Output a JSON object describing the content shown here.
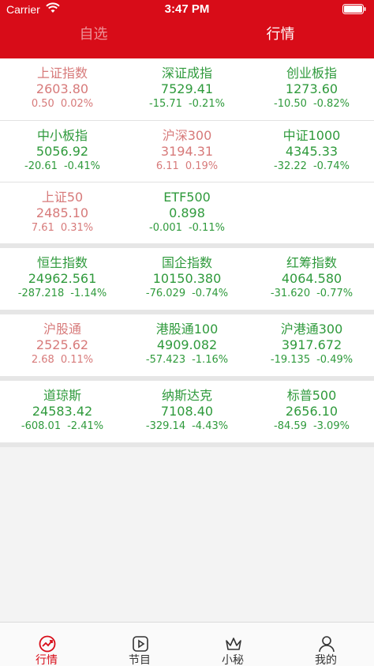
{
  "status_bar": {
    "carrier": "Carrier",
    "time": "3:47 PM"
  },
  "header": {
    "tabs": [
      {
        "label": "自选",
        "active": false
      },
      {
        "label": "行情",
        "active": true
      }
    ]
  },
  "groups": [
    {
      "rows": [
        [
          {
            "name": "上证指数",
            "price": "2603.80",
            "change": "0.50",
            "percent": "0.02%",
            "trend": "up"
          },
          {
            "name": "深证成指",
            "price": "7529.41",
            "change": "-15.71",
            "percent": "-0.21%",
            "trend": "down"
          },
          {
            "name": "创业板指",
            "price": "1273.60",
            "change": "-10.50",
            "percent": "-0.82%",
            "trend": "down"
          }
        ],
        [
          {
            "name": "中小板指",
            "price": "5056.92",
            "change": "-20.61",
            "percent": "-0.41%",
            "trend": "down"
          },
          {
            "name": "沪深300",
            "price": "3194.31",
            "change": "6.11",
            "percent": "0.19%",
            "trend": "up"
          },
          {
            "name": "中证1000",
            "price": "4345.33",
            "change": "-32.22",
            "percent": "-0.74%",
            "trend": "down"
          }
        ],
        [
          {
            "name": "上证50",
            "price": "2485.10",
            "change": "7.61",
            "percent": "0.31%",
            "trend": "up"
          },
          {
            "name": "ETF500",
            "price": "0.898",
            "change": "-0.001",
            "percent": "-0.11%",
            "trend": "down"
          }
        ]
      ]
    },
    {
      "rows": [
        [
          {
            "name": "恒生指数",
            "price": "24962.561",
            "change": "-287.218",
            "percent": "-1.14%",
            "trend": "down"
          },
          {
            "name": "国企指数",
            "price": "10150.380",
            "change": "-76.029",
            "percent": "-0.74%",
            "trend": "down"
          },
          {
            "name": "红筹指数",
            "price": "4064.580",
            "change": "-31.620",
            "percent": "-0.77%",
            "trend": "down"
          }
        ]
      ]
    },
    {
      "rows": [
        [
          {
            "name": "沪股通",
            "price": "2525.62",
            "change": "2.68",
            "percent": "0.11%",
            "trend": "up"
          },
          {
            "name": "港股通100",
            "price": "4909.082",
            "change": "-57.423",
            "percent": "-1.16%",
            "trend": "down"
          },
          {
            "name": "沪港通300",
            "price": "3917.672",
            "change": "-19.135",
            "percent": "-0.49%",
            "trend": "down"
          }
        ]
      ]
    },
    {
      "rows": [
        [
          {
            "name": "道琼斯",
            "price": "24583.42",
            "change": "-608.01",
            "percent": "-2.41%",
            "trend": "down"
          },
          {
            "name": "纳斯达克",
            "price": "7108.40",
            "change": "-329.14",
            "percent": "-4.43%",
            "trend": "down"
          },
          {
            "name": "标普500",
            "price": "2656.10",
            "change": "-84.59",
            "percent": "-3.09%",
            "trend": "down"
          }
        ]
      ]
    }
  ],
  "bottom_nav": [
    {
      "label": "行情",
      "icon": "market-chart-icon",
      "active": true
    },
    {
      "label": "节目",
      "icon": "play-video-icon",
      "active": false
    },
    {
      "label": "小秘",
      "icon": "crown-icon",
      "active": false
    },
    {
      "label": "我的",
      "icon": "user-profile-icon",
      "active": false
    }
  ],
  "colors": {
    "header_red": "#d80c18",
    "up_red": "#d77a7a",
    "down_green": "#2f9a3c"
  }
}
